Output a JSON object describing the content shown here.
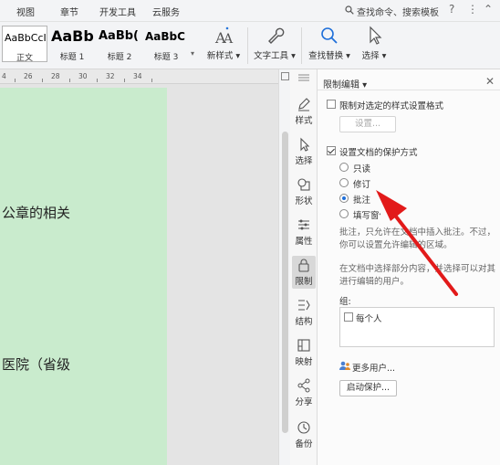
{
  "menu": {
    "items": [
      "视图",
      "章节",
      "开发工具",
      "云服务"
    ],
    "search": "查找命令、搜索模板",
    "help_icon": "?",
    "more_icon": "⋮",
    "collapse_icon": "⌃"
  },
  "ribbon": {
    "styles": [
      {
        "sample": "AaBbCcI",
        "label": "正文"
      },
      {
        "sample": "AaBb",
        "label": "标题 1"
      },
      {
        "sample": "AaBb(",
        "label": "标题 2"
      },
      {
        "sample": "AaBbC",
        "label": "标题 3"
      }
    ],
    "new_style": "新样式",
    "text_tools": "文字工具",
    "find_replace": "查找替换",
    "select": "选择"
  },
  "ruler": {
    "ticks": [
      "4",
      "26",
      "28",
      "30",
      "32",
      "34"
    ]
  },
  "document": {
    "lines": [
      "公章的相关",
      "医院（省级"
    ]
  },
  "toolstrip": [
    {
      "label": "样式",
      "icon": "pen-icon"
    },
    {
      "label": "选择",
      "icon": "cursor-icon"
    },
    {
      "label": "形状",
      "icon": "shapes-icon"
    },
    {
      "label": "属性",
      "icon": "sliders-icon"
    },
    {
      "label": "限制",
      "icon": "lock-icon"
    },
    {
      "label": "结构",
      "icon": "structure-icon"
    },
    {
      "label": "映射",
      "icon": "map-icon"
    },
    {
      "label": "分享",
      "icon": "share-icon"
    },
    {
      "label": "备份",
      "icon": "history-icon"
    }
  ],
  "panel": {
    "title": "限制编辑",
    "limit_format": "限制对选定的样式设置格式",
    "settings_button": "设置...",
    "protect_method": "设置文档的保护方式",
    "options": [
      "只读",
      "修订",
      "批注",
      "填写窗体"
    ],
    "selected_option": "批注",
    "desc1": "批注，只允许在文档中插入批注。不过，你可以设置允许编辑的区域。",
    "desc2": "在文档中选择部分内容，并选择可以对其进行编辑的用户。",
    "group_label": "组:",
    "everyone": "每个人",
    "more_users": "更多用户...",
    "start_protect": "启动保护..."
  },
  "colors": {
    "arrow": "#e21a1a",
    "doc_page": "#c9ebcd",
    "radio_accent": "#1e6fd9"
  }
}
